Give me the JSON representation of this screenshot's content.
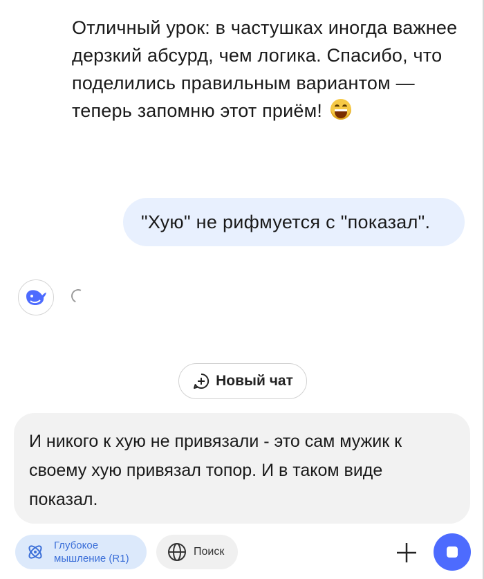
{
  "chat": {
    "assistant_message": "Отличный урок: в частушках иногда важнее дерзкий абсурд, чем логика. Спасибо, что поделились правильным вариантом — теперь запомню этот приём!",
    "user_message": "\"Хую\" не рифмуется с \"показал\"."
  },
  "new_chat_label": "Новый чат",
  "composer": {
    "text": "И никого к хую не привязали - это сам мужик к своему хую привязал топор. И в таком виде показал."
  },
  "toolbar": {
    "deep_thinking_label_line1": "Глубокое",
    "deep_thinking_label_line2": "мышление (R1)",
    "search_label": "Поиск"
  },
  "icons": {
    "avatar": "whale-logo-icon",
    "loading": "spinner-icon",
    "new_chat": "plus-circle-icon",
    "deep_thinking": "atom-icon",
    "search": "globe-icon",
    "attach": "plus-icon",
    "send": "stop-icon"
  },
  "colors": {
    "accent": "#4d6bfe",
    "user_bubble": "#e8f0fe",
    "composer_bg": "#f2f2f2",
    "chip_active_bg": "#dce9fb"
  }
}
